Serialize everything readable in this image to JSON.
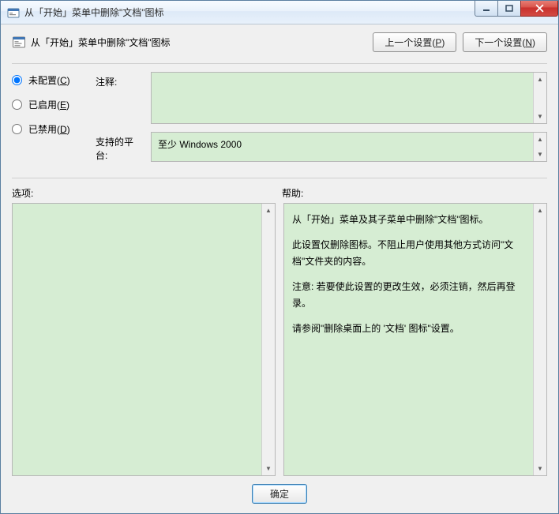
{
  "window": {
    "title": "从「开始」菜单中删除\"文档\"图标"
  },
  "header": {
    "setting_title": "从「开始」菜单中删除\"文档\"图标",
    "prev_label": "上一个设置(P)",
    "prev_key": "P",
    "next_label": "下一个设置(N)",
    "next_key": "N"
  },
  "radios": {
    "not_configured": {
      "label": "未配置(C)",
      "key": "C",
      "checked": true
    },
    "enabled": {
      "label": "已启用(E)",
      "key": "E",
      "checked": false
    },
    "disabled": {
      "label": "已禁用(D)",
      "key": "D",
      "checked": false
    }
  },
  "fields": {
    "comment_label": "注释:",
    "comment_value": "",
    "platform_label": "支持的平台:",
    "platform_value": "至少 Windows 2000"
  },
  "section_labels": {
    "options": "选项:",
    "help": "帮助:"
  },
  "help": {
    "p1": "从「开始」菜单及其子菜单中删除\"文档\"图标。",
    "p2": "此设置仅删除图标。不阻止用户使用其他方式访问\"文档\"文件夹的内容。",
    "p3": "注意: 若要使此设置的更改生效，必须注销，然后再登录。",
    "p4": "请参阅\"删除桌面上的 '文档' 图标\"设置。"
  },
  "footer": {
    "ok_label": "确定"
  }
}
